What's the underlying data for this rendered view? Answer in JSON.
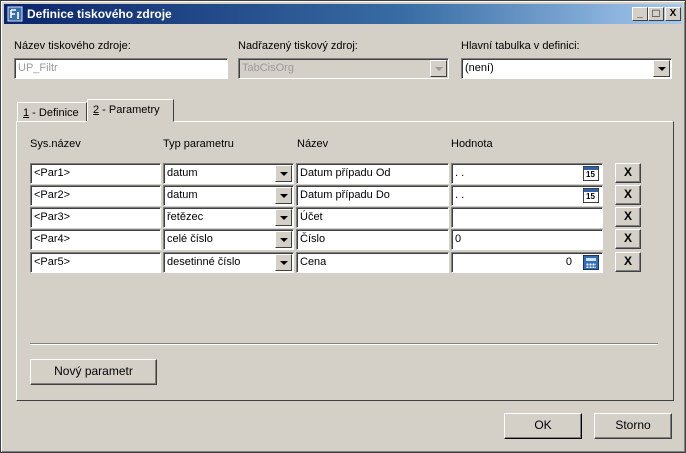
{
  "window": {
    "title": "Definice tiskového zdroje",
    "minimize": "_",
    "maximize": "□",
    "close": "X"
  },
  "form": {
    "source_name_label": "Název tiskového zdroje:",
    "source_name_value": "UP_Filtr",
    "parent_source_label": "Nadřazený tiskový zdroj:",
    "parent_source_value": "TabCisOrg",
    "main_table_label": "Hlavní tabulka v definici:",
    "main_table_value": "(není)"
  },
  "tabs": [
    {
      "num": "1",
      "label": " - Definice"
    },
    {
      "num": "2",
      "label": " - Parametry"
    }
  ],
  "params": {
    "headers": {
      "sys_name": "Sys.název",
      "type": "Typ parametru",
      "name": "Název",
      "value": "Hodnota"
    },
    "rows": [
      {
        "sys": "<Par1>",
        "type": "datum",
        "name": "Datum případu Od",
        "value": " .  .",
        "widget": "calendar-icon"
      },
      {
        "sys": "<Par2>",
        "type": "datum",
        "name": "Datum případu Do",
        "value": " .  .",
        "widget": "calendar-icon"
      },
      {
        "sys": "<Par3>",
        "type": "řetězec",
        "name": "Účet",
        "value": "",
        "widget": ""
      },
      {
        "sys": "<Par4>",
        "type": "celé číslo",
        "name": "Číslo",
        "value": "0",
        "widget": ""
      },
      {
        "sys": "<Par5>",
        "type": "desetinné číslo",
        "name": "Cena",
        "value": "0",
        "widget": "calculator-icon"
      }
    ],
    "delete_label": "X",
    "calendar_glyph": "15",
    "new_param_label": "Nový parametr"
  },
  "footer": {
    "ok_label": "OK",
    "cancel_label": "Storno"
  }
}
